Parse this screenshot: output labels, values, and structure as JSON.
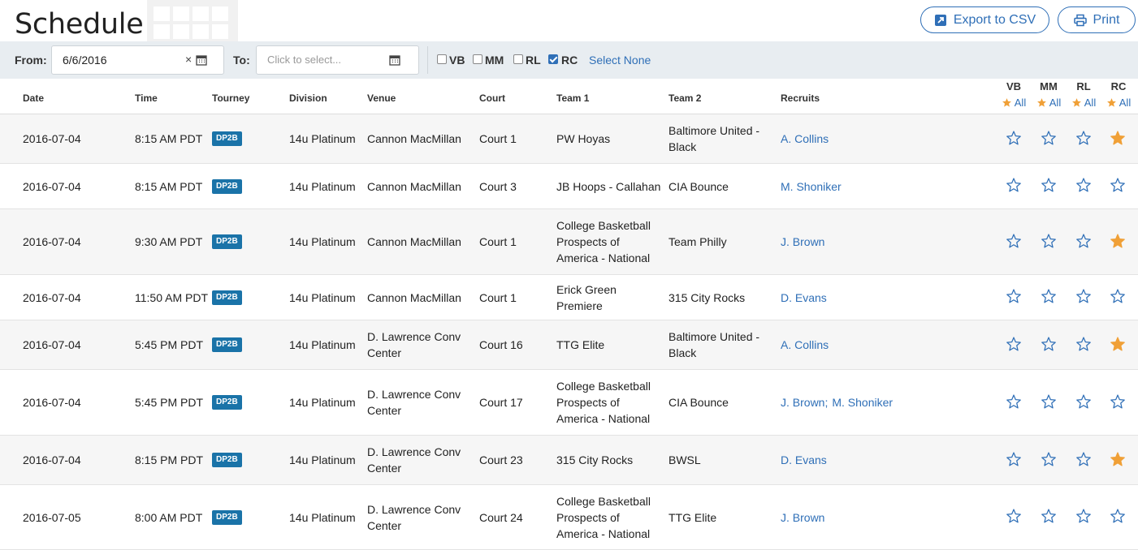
{
  "header": {
    "title": "Schedule",
    "export_label": "Export to CSV",
    "print_label": "Print"
  },
  "filters": {
    "from_label": "From:",
    "from_value": "6/6/2016",
    "clear_glyph": "×",
    "to_label": "To:",
    "to_placeholder": "Click to select...",
    "checks": [
      {
        "label": "VB",
        "checked": false
      },
      {
        "label": "MM",
        "checked": false
      },
      {
        "label": "RL",
        "checked": false
      },
      {
        "label": "RC",
        "checked": true
      }
    ],
    "select_none": "Select None"
  },
  "columns": {
    "date": "Date",
    "time": "Time",
    "tourney": "Tourney",
    "division": "Division",
    "venue": "Venue",
    "court": "Court",
    "team1": "Team 1",
    "team2": "Team 2",
    "recruits": "Recruits",
    "recruiters": [
      "VB",
      "MM",
      "RL",
      "RC"
    ],
    "all_label": "All"
  },
  "colors": {
    "accent": "#2f6fb7",
    "star_filled": "#f0a037",
    "badge": "#1a73a8"
  },
  "rows": [
    {
      "date": "2016-07-04",
      "time": "8:15 AM PDT",
      "tourney": "DP2B",
      "division": "14u Platinum",
      "venue": "Cannon MacMillan",
      "court": "Court 1",
      "team1": "PW Hoyas",
      "team2": "Baltimore United - Black",
      "recruits": [
        "A. Collins"
      ],
      "stars": [
        false,
        false,
        false,
        true
      ]
    },
    {
      "date": "2016-07-04",
      "time": "8:15 AM PDT",
      "tourney": "DP2B",
      "division": "14u Platinum",
      "venue": "Cannon MacMillan",
      "court": "Court 3",
      "team1": "JB Hoops - Callahan",
      "team2": "CIA Bounce",
      "recruits": [
        "M. Shoniker"
      ],
      "stars": [
        false,
        false,
        false,
        false
      ]
    },
    {
      "date": "2016-07-04",
      "time": "9:30 AM PDT",
      "tourney": "DP2B",
      "division": "14u Platinum",
      "venue": "Cannon MacMillan",
      "court": "Court 1",
      "team1": "College Basketball Prospects of America - National",
      "team2": "Team Philly",
      "recruits": [
        "J. Brown"
      ],
      "stars": [
        false,
        false,
        false,
        true
      ]
    },
    {
      "date": "2016-07-04",
      "time": "11:50 AM PDT",
      "tourney": "DP2B",
      "division": "14u Platinum",
      "venue": "Cannon MacMillan",
      "court": "Court 1",
      "team1": "Erick Green Premiere",
      "team2": "315 City Rocks",
      "recruits": [
        "D. Evans"
      ],
      "stars": [
        false,
        false,
        false,
        false
      ]
    },
    {
      "date": "2016-07-04",
      "time": "5:45 PM PDT",
      "tourney": "DP2B",
      "division": "14u Platinum",
      "venue": "D. Lawrence Conv Center",
      "court": "Court 16",
      "team1": "TTG Elite",
      "team2": "Baltimore United - Black",
      "recruits": [
        "A. Collins"
      ],
      "stars": [
        false,
        false,
        false,
        true
      ]
    },
    {
      "date": "2016-07-04",
      "time": "5:45 PM PDT",
      "tourney": "DP2B",
      "division": "14u Platinum",
      "venue": "D. Lawrence Conv Center",
      "court": "Court 17",
      "team1": "College Basketball Prospects of America - National",
      "team2": "CIA Bounce",
      "recruits": [
        "J. Brown;",
        "M. Shoniker"
      ],
      "stars": [
        false,
        false,
        false,
        false
      ]
    },
    {
      "date": "2016-07-04",
      "time": "8:15 PM PDT",
      "tourney": "DP2B",
      "division": "14u Platinum",
      "venue": "D. Lawrence Conv Center",
      "court": "Court 23",
      "team1": "315 City Rocks",
      "team2": "BWSL",
      "recruits": [
        "D. Evans"
      ],
      "stars": [
        false,
        false,
        false,
        true
      ]
    },
    {
      "date": "2016-07-05",
      "time": "8:00 AM PDT",
      "tourney": "DP2B",
      "division": "14u Platinum",
      "venue": "D. Lawrence Conv Center",
      "court": "Court 24",
      "team1": "College Basketball Prospects of America - National",
      "team2": "TTG Elite",
      "recruits": [
        "J. Brown"
      ],
      "stars": [
        false,
        false,
        false,
        false
      ]
    }
  ]
}
